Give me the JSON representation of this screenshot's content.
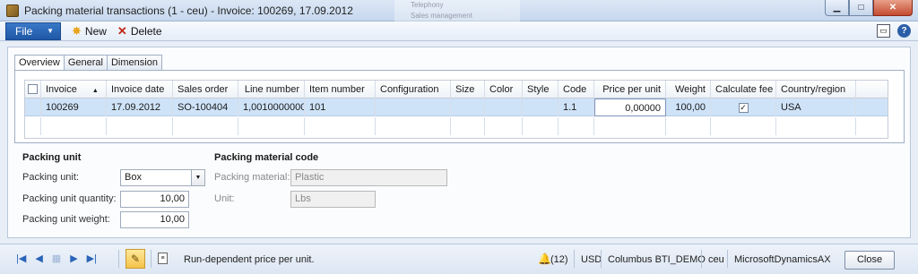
{
  "window": {
    "title": "Packing material transactions (1 - ceu) - Invoice: 100269, 17.09.2012",
    "background_menu": [
      "Telephony",
      "Sales management"
    ]
  },
  "toolbar": {
    "file_label": "File",
    "new_label": "New",
    "delete_label": "Delete"
  },
  "tabs": [
    "Overview",
    "General",
    "Dimension"
  ],
  "grid": {
    "columns": [
      "",
      "Invoice",
      "Invoice date",
      "Sales order",
      "Line number",
      "Item number",
      "Configuration",
      "Size",
      "Color",
      "Style",
      "Code",
      "Price per unit",
      "Weight",
      "Calculate fee",
      "Country/region",
      ""
    ],
    "sort_indicator": "▲",
    "rows": [
      {
        "invoice": "100269",
        "invoice_date": "17.09.2012",
        "sales_order": "SO-100404",
        "line_number": "1,0010000000",
        "item_number": "101",
        "configuration": "",
        "size": "",
        "color": "",
        "style": "",
        "code": "1.1",
        "price_per_unit": "0,00000",
        "weight": "100,00",
        "calculate_fee": "✓",
        "country_region": "USA"
      }
    ]
  },
  "packing_unit": {
    "title": "Packing unit",
    "unit_label": "Packing unit:",
    "unit_value": "Box",
    "quantity_label": "Packing unit quantity:",
    "quantity_value": "10,00",
    "weight_label": "Packing unit weight:",
    "weight_value": "10,00"
  },
  "packing_material_code": {
    "title": "Packing material code",
    "material_label": "Packing material:",
    "material_value": "Plastic",
    "unit_label": "Unit:",
    "unit_value": "Lbs"
  },
  "statusbar": {
    "message": "Run-dependent price per unit.",
    "notifications": "(12)",
    "currency": "USD",
    "company": "Columbus BTI_DEMO",
    "partition": "ceu",
    "application": "MicrosoftDynamicsAX",
    "close_label": "Close"
  },
  "colors": {
    "selected_row": "#cfe3f8",
    "file_button": "#2b67b8"
  }
}
